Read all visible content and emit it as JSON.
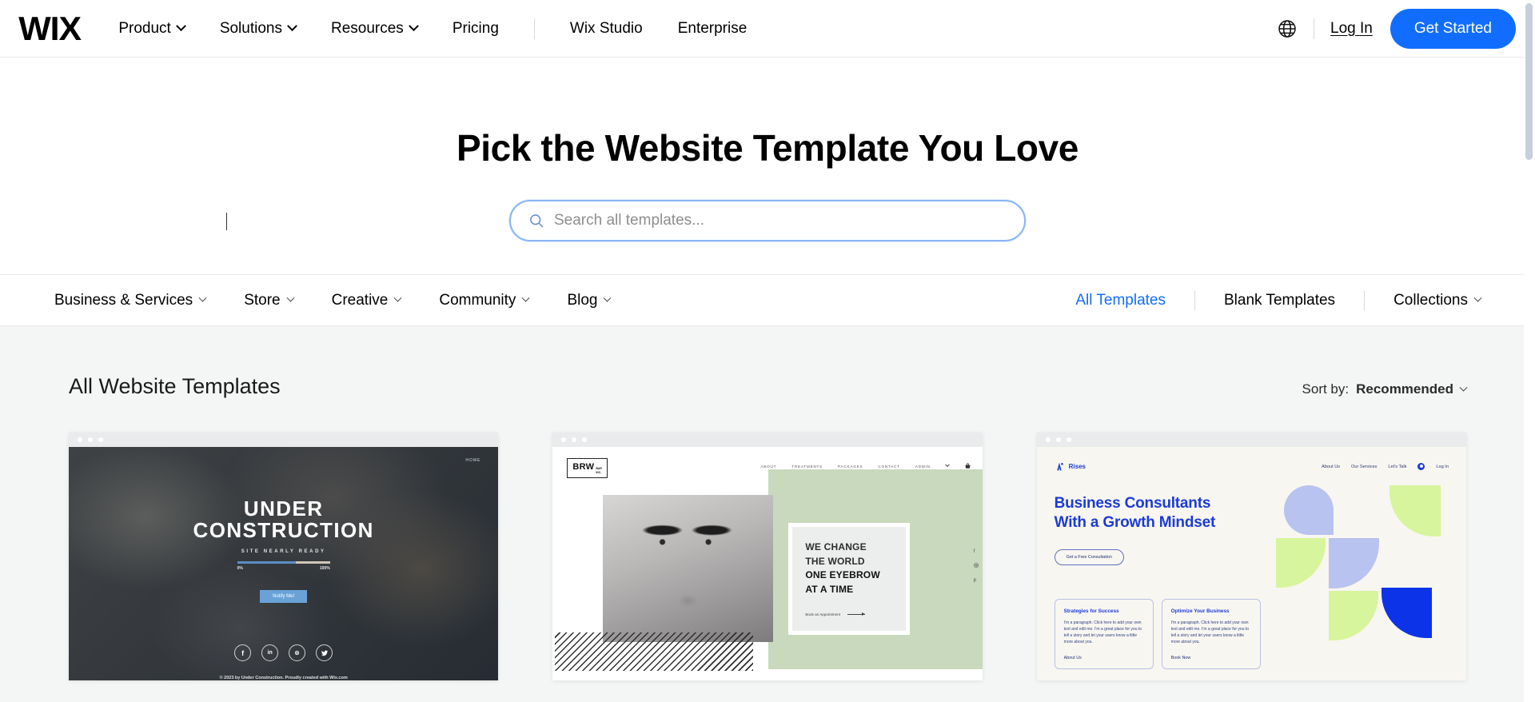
{
  "header": {
    "logo": "WIX",
    "nav_items": [
      {
        "label": "Product",
        "has_chevron": true
      },
      {
        "label": "Solutions",
        "has_chevron": true
      },
      {
        "label": "Resources",
        "has_chevron": true
      },
      {
        "label": "Pricing",
        "has_chevron": false
      }
    ],
    "nav_items_right": [
      {
        "label": "Wix Studio"
      },
      {
        "label": "Enterprise"
      }
    ],
    "globe_icon": "globe-icon",
    "login_label": "Log In",
    "cta_label": "Get Started",
    "cta_color": "#116dff"
  },
  "hero": {
    "title": "Pick the Website Template You Love",
    "search": {
      "placeholder": "Search all templates...",
      "value": "",
      "icon": "search-icon",
      "border_color": "#8ab4f8"
    }
  },
  "categories": {
    "left": [
      {
        "label": "Business & Services",
        "has_chevron": true
      },
      {
        "label": "Store",
        "has_chevron": true
      },
      {
        "label": "Creative",
        "has_chevron": true
      },
      {
        "label": "Community",
        "has_chevron": true
      },
      {
        "label": "Blog",
        "has_chevron": true
      }
    ],
    "right": [
      {
        "label": "All Templates",
        "active": true,
        "has_chevron": false
      },
      {
        "label": "Blank Templates",
        "active": false,
        "has_chevron": false
      },
      {
        "label": "Collections",
        "active": false,
        "has_chevron": true
      }
    ],
    "active_color": "#116dff"
  },
  "main": {
    "section_title": "All Website Templates",
    "sort": {
      "label": "Sort by:",
      "value": "Recommended"
    }
  },
  "templates": [
    {
      "name": "under-construction",
      "nav_item": "HOME",
      "title_line1": "UNDER",
      "title_line2": "CONSTRUCTION",
      "subtitle": "SITE NEARLY READY",
      "progress_min": "0%",
      "progress_max": "100%",
      "progress_percent": 63,
      "button_label": "Notify Me!",
      "socials": [
        "facebook-icon",
        "linkedin-icon",
        "instagram-icon",
        "twitter-icon"
      ],
      "footer": "© 2023 by Under Construction. Proudly created with Wix.com"
    },
    {
      "name": "brw-bar",
      "logo_main": "BRW",
      "logo_sub_line1": "BAR",
      "logo_sub_line2": "INC.",
      "nav": [
        "ABOUT",
        "TREATMENTS",
        "PACKAGES",
        "CONTACT",
        "ADMIN"
      ],
      "cart_icon": "cart-icon",
      "headline_line1": "WE CHANGE",
      "headline_line2": "THE WORLD",
      "headline_line3": "ONE EYEBROW",
      "headline_line4": "AT A TIME",
      "cta_label": "Book an Appointment",
      "side_socials": [
        "facebook-icon",
        "instagram-icon",
        "pinterest-icon"
      ],
      "accent_color": "#c9d9bd"
    },
    {
      "name": "rises-consultants",
      "logo_name": "Rises",
      "nav": [
        "About Us",
        "Our Services",
        "Let's Talk"
      ],
      "login_label": "Log In",
      "headline_line1": "Business Consultants",
      "headline_line2": "With a Growth Mindset",
      "cta_label": "Get a Free Consultation",
      "cards": [
        {
          "title": "Strategies for Success",
          "paragraph": "I'm a paragraph. Click here to add your own text and edit me. I'm a great place for you to tell a story and let your users know a little more about you.",
          "link": "About Us"
        },
        {
          "title": "Optimize Your Business",
          "paragraph": "I'm a paragraph. Click here to add your own text and edit me. I'm a great place for you to tell a story and let your users know a little more about you.",
          "link": "Book Now"
        }
      ],
      "colors": {
        "background": "#f8f6f0",
        "brand_blue": "#1b3bd6",
        "periwinkle": "#b8c3ef",
        "lime": "#d7f59c",
        "vivid_blue": "#0d33e8"
      }
    }
  ],
  "scrollbar": {
    "thumb_color": "#c5d0dc"
  }
}
